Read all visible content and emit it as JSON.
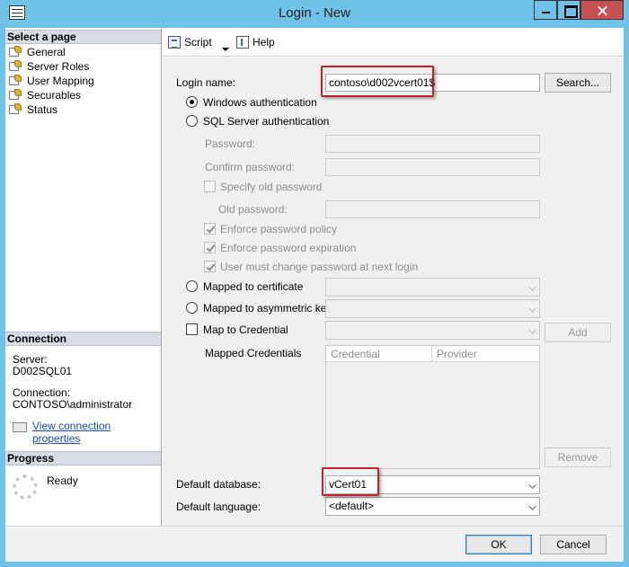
{
  "window": {
    "title": "Login - New"
  },
  "left_pane": {
    "select_page_header": "Select a page",
    "pages": [
      {
        "label": "General",
        "icon": "page-wrench-icon"
      },
      {
        "label": "Server Roles",
        "icon": "page-wrench-icon"
      },
      {
        "label": "User Mapping",
        "icon": "page-wrench-icon"
      },
      {
        "label": "Securables",
        "icon": "page-wrench-icon"
      },
      {
        "label": "Status",
        "icon": "page-wrench-icon"
      }
    ],
    "connection_header": "Connection",
    "server_label": "Server:",
    "server_value": "D002SQL01",
    "connection_label": "Connection:",
    "connection_value": "CONTOSO\\administrator",
    "view_properties_link": "View connection properties",
    "progress_header": "Progress",
    "progress_status": "Ready"
  },
  "toolbar": {
    "script_label": "Script",
    "help_label": "Help"
  },
  "form": {
    "login_name_label": "Login name:",
    "login_name_value": "contoso\\d002vcert01$",
    "search_button": "Search...",
    "windows_auth_label": "Windows authentication",
    "sql_auth_label": "SQL Server authentication",
    "password_label": "Password:",
    "confirm_password_label": "Confirm password:",
    "specify_old_password_label": "Specify old password",
    "old_password_label": "Old password:",
    "enforce_policy_label": "Enforce password policy",
    "enforce_expiration_label": "Enforce password expiration",
    "must_change_label": "User must change password at next login",
    "mapped_certificate_label": "Mapped to certificate",
    "mapped_asymmetric_label": "Mapped to asymmetric key",
    "map_credential_label": "Map to Credential",
    "add_button": "Add",
    "mapped_credentials_label": "Mapped Credentials",
    "credentials_columns": [
      "Credential",
      "Provider"
    ],
    "remove_button": "Remove",
    "default_database_label": "Default database:",
    "default_database_value": "vCert01",
    "default_language_label": "Default language:",
    "default_language_value": "<default>"
  },
  "buttons": {
    "ok": "OK",
    "cancel": "Cancel"
  },
  "colors": {
    "title_bar": "#6fc2e8",
    "highlight": "#c0242a",
    "link": "#1a4fb3"
  }
}
